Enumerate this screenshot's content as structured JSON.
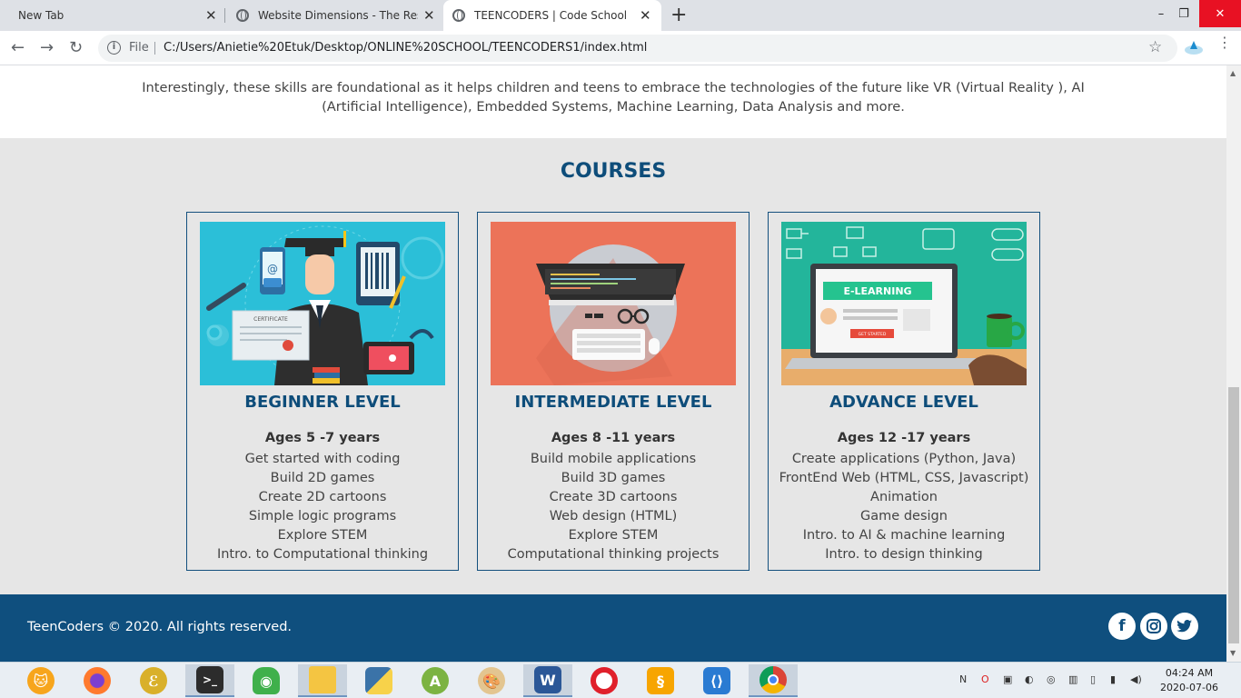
{
  "browser": {
    "tabs": [
      {
        "title": "New Tab"
      },
      {
        "title": "Website Dimensions - The Resou"
      },
      {
        "title": "TEENCODERS | Code School"
      }
    ],
    "close_glyph": "✕",
    "new_tab_glyph": "+",
    "file_label": "File",
    "url": "C:/Users/Anietie%20Etuk/Desktop/ONLINE%20SCHOOL/TEENCODERS1/index.html",
    "window_controls": [
      "–",
      "❐",
      "✕"
    ]
  },
  "page": {
    "intro_text": "Interestingly, these skills are foundational as it helps children and teens to embrace the technologies of the future like VR (Virtual Reality ), AI (Artificial Intelligence), Embedded Systems, Machine Learning, Data Analysis and more.",
    "courses_title": "COURSES",
    "courses": [
      {
        "title": "BEGINNER LEVEL",
        "ages": "Ages 5 -7 years",
        "items": [
          "Get started with coding",
          "Build 2D games",
          "Create 2D cartoons",
          "Simple logic programs",
          "Explore STEM",
          "Intro. to Computational thinking"
        ]
      },
      {
        "title": "INTERMEDIATE LEVEL",
        "ages": "Ages 8 -11 years",
        "items": [
          "Build mobile applications",
          "Build 3D games",
          "Create 3D cartoons",
          "Web design (HTML)",
          "Explore STEM",
          "Computational thinking projects"
        ]
      },
      {
        "title": "ADVANCE LEVEL",
        "ages": "Ages 12 -17 years",
        "items": [
          "Create applications (Python, Java)",
          "FrontEnd Web (HTML, CSS, Javascript)",
          "Animation",
          "Game design",
          "Intro. to AI & machine learning",
          "Intro. to design thinking"
        ]
      }
    ],
    "illustration_text": {
      "certificate": "CERTIFICATE",
      "elearning": "E-LEARNING",
      "get_started": "GET STARTED"
    },
    "footer_text": "TeenCoders © 2020. All rights reserved.",
    "social_icons": [
      "facebook-icon",
      "instagram-icon",
      "twitter-icon"
    ]
  },
  "taskbar": {
    "apps": [
      "scratch",
      "firefox",
      "edraw",
      "terminal",
      "robot",
      "file-explorer",
      "python",
      "android-studio",
      "paint",
      "word",
      "opera",
      "sublime",
      "vscode",
      "chrome"
    ],
    "word_letter": "W",
    "time": "04:24 AM",
    "date": "2020-07-06"
  },
  "colors": {
    "brand_blue": "#0e4d7a",
    "footer_blue": "#0f4f7e",
    "section_bg": "#e6e6e6"
  }
}
